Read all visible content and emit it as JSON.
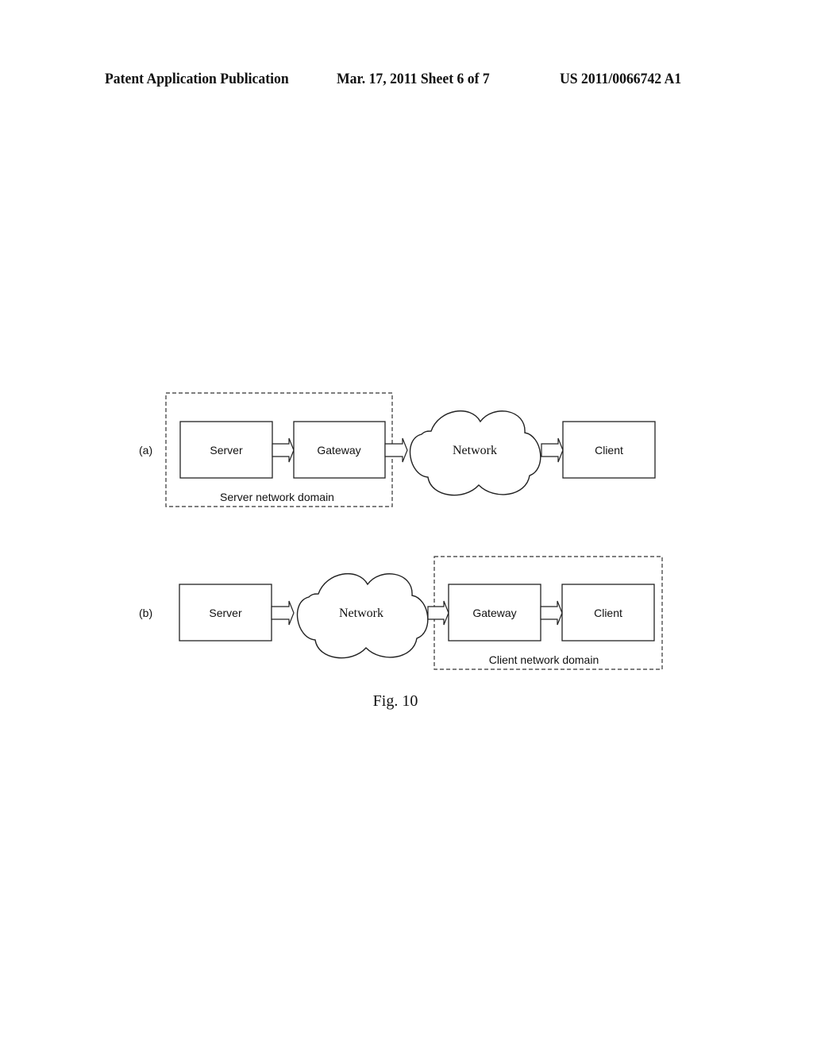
{
  "header": {
    "publication_type": "Patent Application Publication",
    "date_sheet": "Mar. 17, 2011  Sheet 6 of 7",
    "publication_number": "US 2011/0066742 A1"
  },
  "figure": {
    "caption": "Fig. 10",
    "panel_a": {
      "label": "(a)",
      "nodes": {
        "server": "Server",
        "gateway": "Gateway",
        "network": "Network",
        "client": "Client"
      },
      "domain_label": "Server network domain"
    },
    "panel_b": {
      "label": "(b)",
      "nodes": {
        "server": "Server",
        "network": "Network",
        "gateway": "Gateway",
        "client": "Client"
      },
      "domain_label": "Client network domain"
    }
  }
}
